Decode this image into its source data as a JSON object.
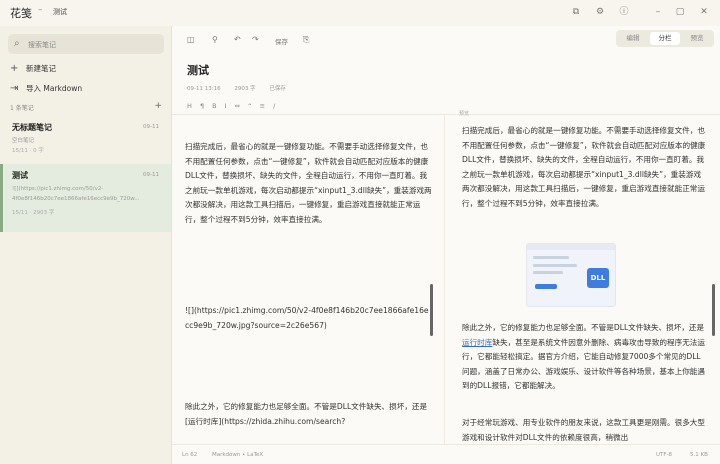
{
  "app": {
    "name": "花笺",
    "separator": "–",
    "document": "测试"
  },
  "sidebar": {
    "search_placeholder": "搜索笔记",
    "actions": [
      {
        "label": "新建笔记"
      },
      {
        "label": "导入 Markdown"
      }
    ],
    "section_label": "1 条笔记",
    "notes": [
      {
        "title": "无标题笔记",
        "date": "09-11",
        "preview": "空白笔记",
        "meta": "15/11 · 0 字"
      },
      {
        "title": "测试",
        "date": "09-11",
        "preview_line1": "![](https://pic1.zhimg.com/50/v2-",
        "preview_line2": "4f0e8f146b20c7ee1866afe16ecc9e9b_720w...",
        "meta": "15/11 · 2903 字"
      }
    ]
  },
  "toolbar": {
    "save_label": "保存"
  },
  "modes": {
    "edit": "编辑",
    "split": "分栏",
    "preview": "预览"
  },
  "doc": {
    "title": "测试",
    "meta": {
      "date": "09-11 13:16",
      "words": "2903 字",
      "status": "已保存"
    },
    "format_bar": "H ¶ B I ⇔ “ ≡ /"
  },
  "source": {
    "para1": "扫描完成后，最省心的就是一键修复功能。不需要手动选择修复文件，也不用配置任何参数，点击“一键修复”，软件就会自动匹配对应版本的健康DLL文件，替换损坏、缺失的文件，全程自动运行，不用你一直盯着。我之前玩一款单机游戏，每次启动都提示“xinput1_3.dll缺失”，重装游戏两次都没解决，用这款工具扫描后，一键修复，重启游戏直接就能正常运行，整个过程不到5分钟，效率直接拉满。",
    "para2": "![](https://pic1.zhimg.com/50/v2-4f0e8f146b20c7ee1866afe16ecc9e9b_720w.jpg?source=2c26e567)",
    "para3": "除此之外，它的修复能力也足够全面。不管是DLL文件缺失、损坏，还是[运行时库](https://zhida.zhihu.com/search?"
  },
  "preview": {
    "label": "预览",
    "para1": "扫描完成后，最省心的就是一键修复功能。不需要手动选择修复文件，也不用配置任何参数，点击“一键修复”，软件就会自动匹配对应版本的健康DLL文件，替换损坏、缺失的文件，全程自动运行，不用你一直盯着。我之前玩一款单机游戏，每次启动都提示“xinput1_3.dll缺失”，重装游戏两次都没解决，用这款工具扫描后，一键修复，重启游戏直接就能正常运行，整个过程不到5分钟，效率直接拉满。",
    "image_text": "DLL",
    "para2_a": "除此之外，它的修复能力也足够全面。不管是DLL文件缺失、损坏，还是",
    "para2_link": "运行时库",
    "para2_b": "缺失，甚至是系统文件因意外删除、病毒攻击导致的程序无法运行，它都能轻松搞定。据官方介绍，它能自动修复7000多个常见的DLL问题，涵盖了日常办公、游戏娱乐、设计软件等各种场景，基本上你能遇到的DLL报错，它都能解决。",
    "para3": "对于经常玩游戏、用专业软件的朋友来说，这款工具更是刚需。很多大型游戏和设计软件对DLL文件的依赖度很高，稍微出"
  },
  "status": {
    "line": "Ln 62",
    "mode": "Markdown • LaTeX",
    "encoding": "UTF-8",
    "size": "5.1 KB"
  }
}
